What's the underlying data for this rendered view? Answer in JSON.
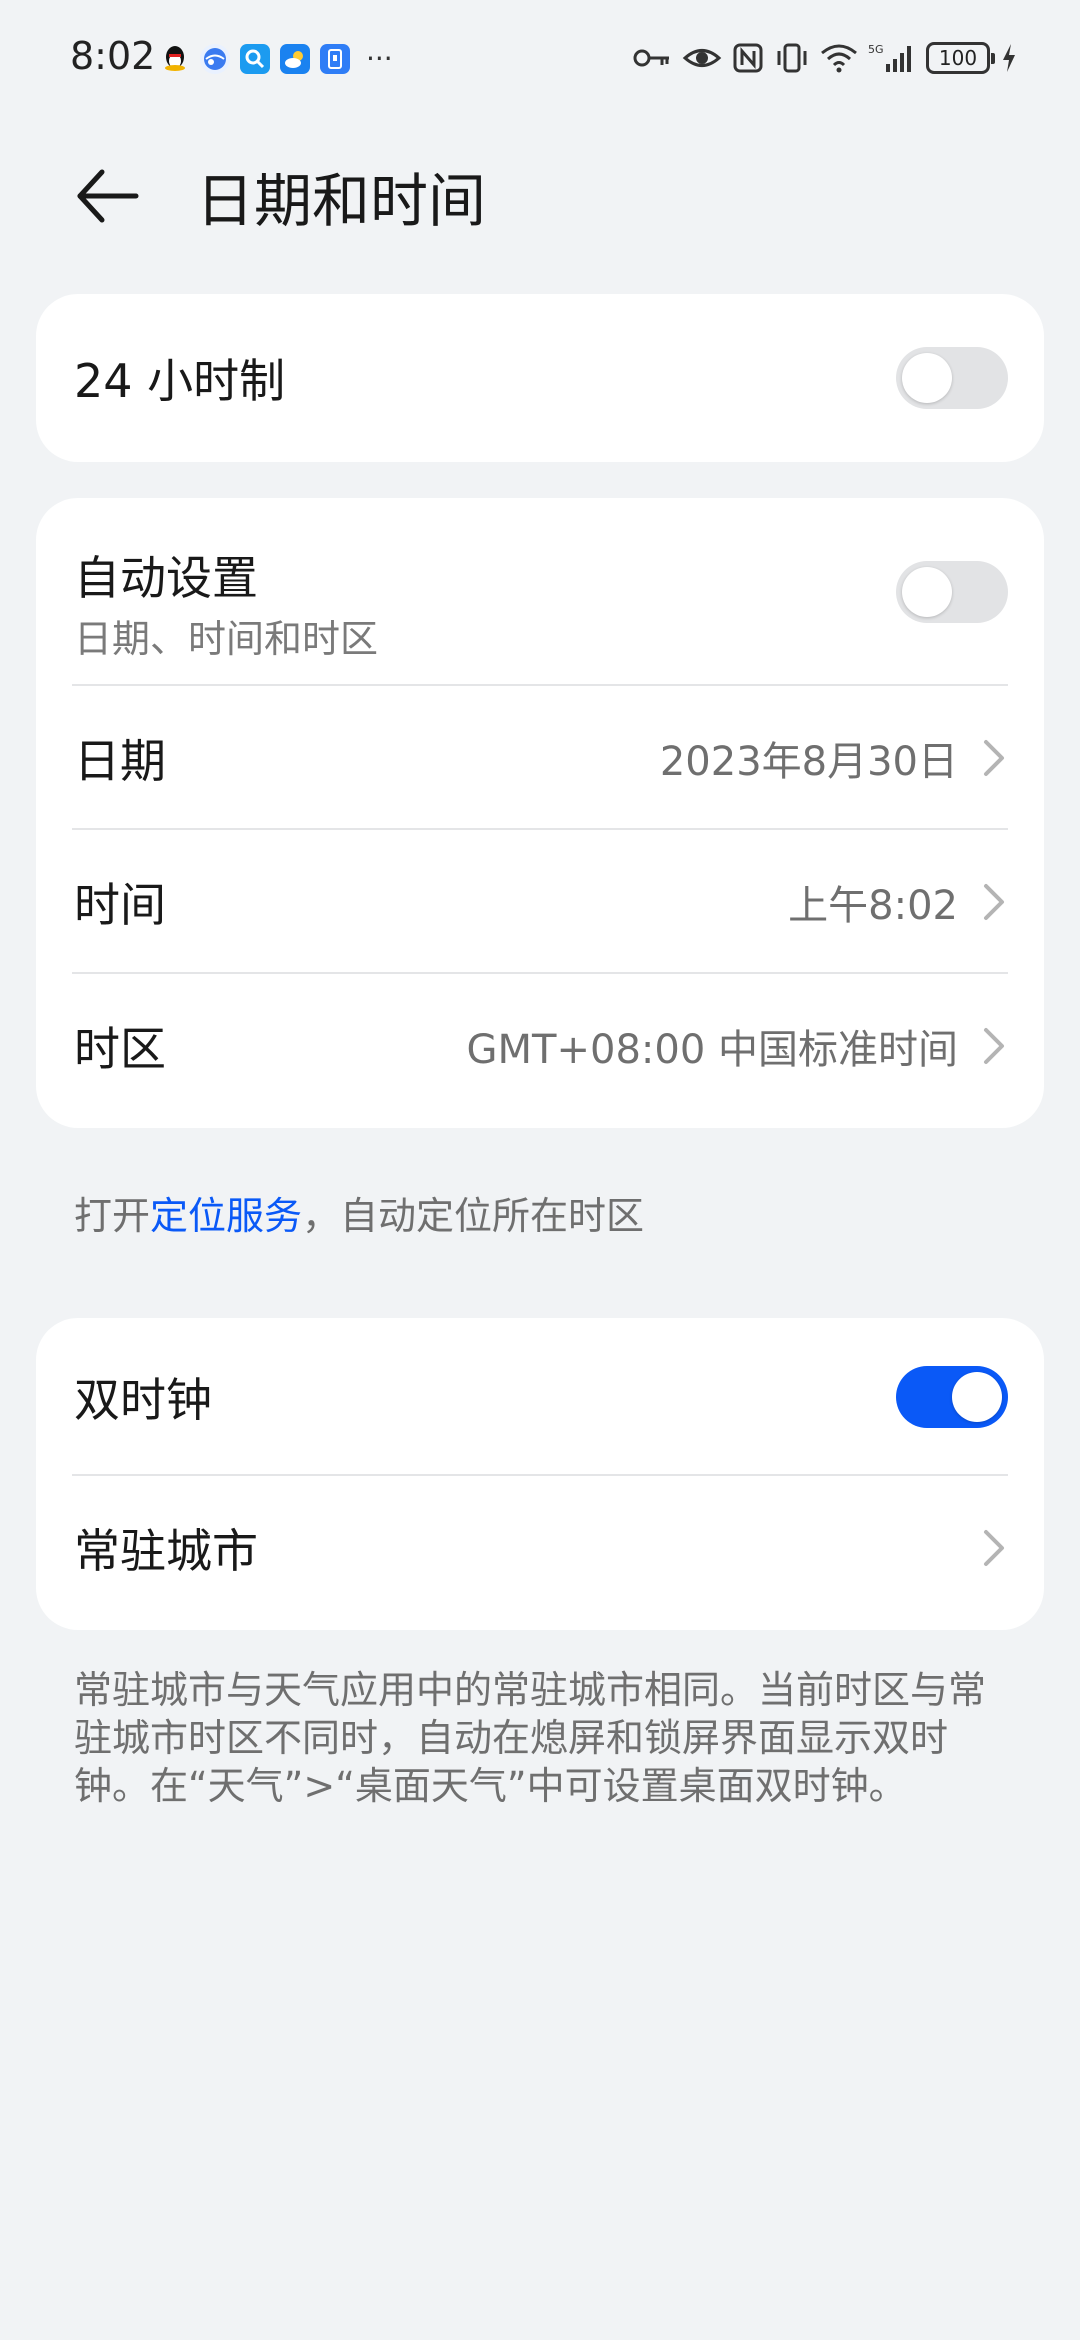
{
  "status_bar": {
    "time": "8:02",
    "more": "···",
    "battery": "100"
  },
  "header": {
    "title": "日期和时间"
  },
  "card_24h": {
    "label": "24 小时制",
    "toggle_on": false
  },
  "card_datetime": {
    "auto": {
      "label": "自动设置",
      "sub": "日期、时间和时区",
      "toggle_on": false
    },
    "date": {
      "label": "日期",
      "value": "2023年8月30日"
    },
    "time": {
      "label": "时间",
      "value": "上午8:02"
    },
    "timezone": {
      "label": "时区",
      "value": "GMT+08:00 中国标准时间"
    }
  },
  "location_note": {
    "prefix": "打开",
    "link": "定位服务",
    "suffix": "，自动定位所在时区"
  },
  "card_dual": {
    "dual_clock": {
      "label": "双时钟",
      "toggle_on": true
    },
    "home_city": {
      "label": "常驻城市"
    }
  },
  "dual_note": {
    "text": "常驻城市与天气应用中的常驻城市相同。当前时区与常驻城市时区不同时，自动在熄屏和锁屏界面显示双时钟。在“天气”>“桌面天气”中可设置桌面双时钟。"
  },
  "colors": {
    "accent": "#0a59f7",
    "background": "#f1f3f5",
    "card": "#ffffff"
  }
}
